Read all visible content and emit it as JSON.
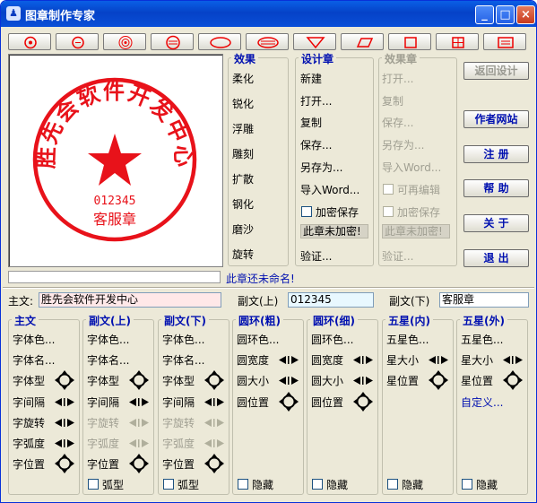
{
  "window": {
    "title": "图章制作专家",
    "min": "_",
    "max": "□",
    "close": "×"
  },
  "toolbar": {
    "shapes": [
      "circle-star",
      "circle-dash",
      "ring-target",
      "circle-stripes",
      "ellipse",
      "ellipse-stripes",
      "triangle-down",
      "parallelogram",
      "square",
      "grid-stamp",
      "rect-stamp"
    ]
  },
  "stamp": {
    "main_text": "胜先会软件开发中心",
    "number": "012345",
    "sub_text": "客服章",
    "color": "#e8121a"
  },
  "effects": {
    "title": "效果",
    "items": [
      "柔化",
      "锐化",
      "浮雕",
      "雕刻",
      "扩散",
      "钢化",
      "磨沙",
      "旋转"
    ]
  },
  "design": {
    "title": "设计章",
    "items": [
      "新建",
      "打开...",
      "复制",
      "保存...",
      "另存为...",
      "导入Word..."
    ],
    "encrypt_save": "加密保存",
    "encrypt_status": "此章未加密!",
    "verify": "验证..."
  },
  "effect_stamp": {
    "title": "效果章",
    "items": [
      "打开...",
      "复制",
      "保存...",
      "另存为...",
      "导入Word..."
    ],
    "editable": "可再编辑",
    "encrypt_save": "加密保存",
    "encrypt_status": "此章未加密!",
    "verify": "验证..."
  },
  "right_buttons": {
    "back": "返回设计",
    "author": "作者网站",
    "register": "注 册",
    "help": "帮 助",
    "about": "关 于",
    "exit": "退 出"
  },
  "status_text": "此章还未命名!",
  "fields": {
    "main_label": "主文:",
    "main_value": "胜先会软件开发中心",
    "sub_up_label": "副文(上)",
    "sub_up_value": "012345",
    "sub_down_label": "副文(下)",
    "sub_down_value": "客服章"
  },
  "panels": {
    "main": {
      "title": "主文",
      "font_color": "字体色...",
      "font_name": "字体名...",
      "font_type": "字体型",
      "spacing": "字间隔",
      "rotate": "字旋转",
      "arc": "字弧度",
      "position": "字位置"
    },
    "sub_up": {
      "title": "副文(上)",
      "font_color": "字体色...",
      "font_name": "字体名...",
      "font_type": "字体型",
      "spacing": "字间隔",
      "rotate": "字旋转",
      "arc": "字弧度",
      "position": "字位置",
      "arc_check": "弧型"
    },
    "sub_down": {
      "title": "副文(下)",
      "font_color": "字体色...",
      "font_name": "字体名...",
      "font_type": "字体型",
      "spacing": "字间隔",
      "rotate": "字旋转",
      "arc": "字弧度",
      "position": "字位置",
      "arc_check": "弧型"
    },
    "ring_thick": {
      "title": "圆环(粗)",
      "color": "圆环色...",
      "width": "圆宽度",
      "size": "圆大小",
      "position": "圆位置",
      "hide": "隐藏"
    },
    "ring_thin": {
      "title": "圆环(细)",
      "color": "圆环色...",
      "width": "圆宽度",
      "size": "圆大小",
      "position": "圆位置",
      "hide": "隐藏"
    },
    "star_in": {
      "title": "五星(内)",
      "color": "五星色...",
      "size": "星大小",
      "position": "星位置",
      "hide": "隐藏"
    },
    "star_out": {
      "title": "五星(外)",
      "color": "五星色...",
      "size": "星大小",
      "position": "星位置",
      "custom": "自定义...",
      "hide": "隐藏"
    }
  }
}
